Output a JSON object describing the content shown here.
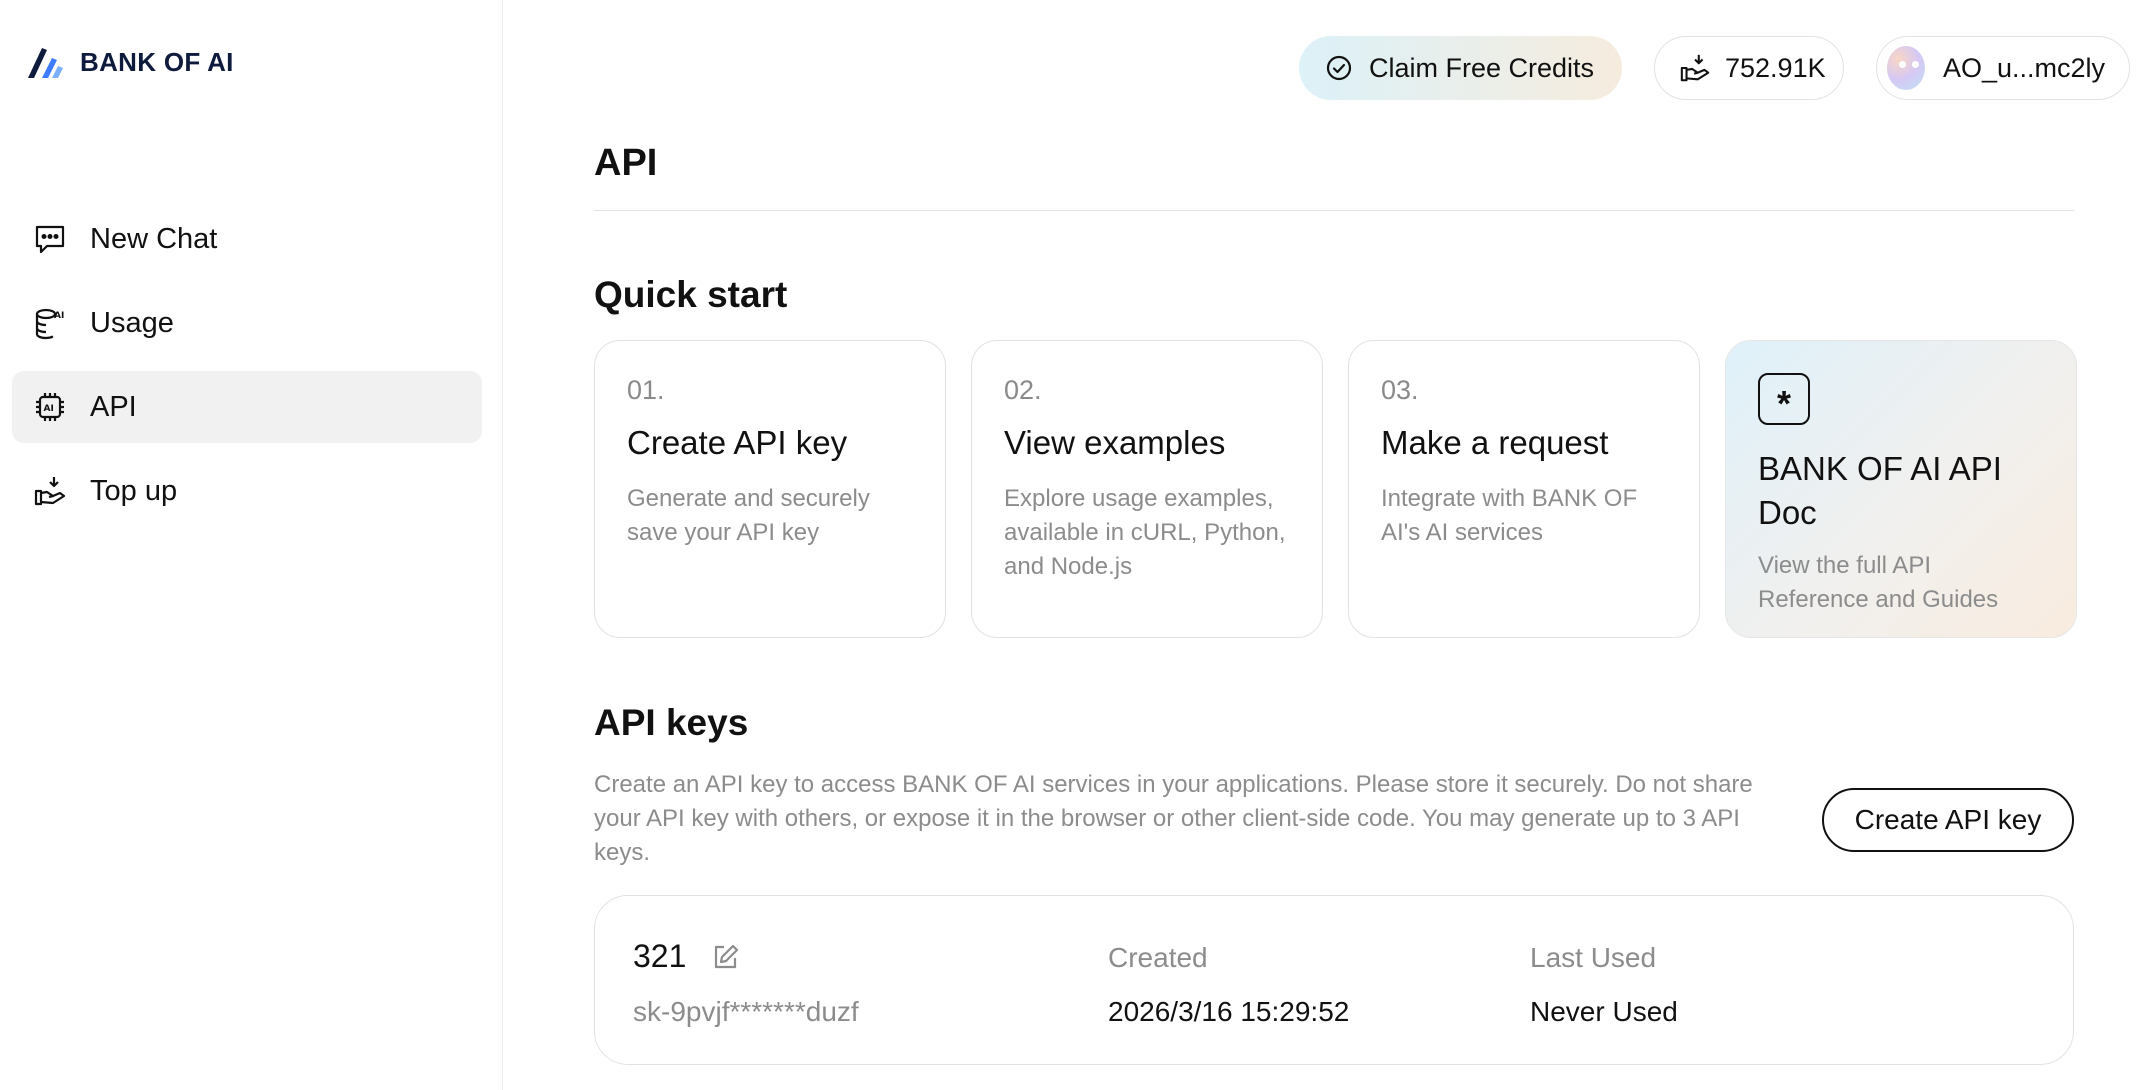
{
  "brand": {
    "name": "BANK OF AI"
  },
  "sidebar": {
    "items": [
      {
        "label": "New Chat",
        "icon": "chat-bubble-icon"
      },
      {
        "label": "Usage",
        "icon": "database-ai-icon"
      },
      {
        "label": "API",
        "icon": "ai-chip-icon",
        "active": true
      },
      {
        "label": "Top up",
        "icon": "hand-coin-icon"
      }
    ]
  },
  "header": {
    "claim_label": "Claim Free Credits",
    "balance": "752.91K",
    "username": "AO_u...mc2ly"
  },
  "page": {
    "title": "API",
    "quick_start": {
      "title": "Quick start",
      "cards": [
        {
          "num": "01.",
          "title": "Create API key",
          "desc": "Generate and securely save your API key"
        },
        {
          "num": "02.",
          "title": "View examples",
          "desc": "Explore usage examples, available in cURL, Python, and Node.js"
        },
        {
          "num": "03.",
          "title": "Make a request",
          "desc": "Integrate with BANK OF AI's AI services"
        }
      ],
      "doc_card": {
        "icon_glyph": "*",
        "title": "BANK OF AI API Doc",
        "desc": "View the full API Reference and Guides"
      }
    },
    "api_keys": {
      "title": "API keys",
      "description": "Create an API key to access BANK OF AI services in your applications. Please store it securely. Do not share your API key with others, or expose it in the browser or other client-side code. You may generate up to 3 API keys.",
      "create_label": "Create API key",
      "keys": [
        {
          "name": "321",
          "value": "sk-9pvjf*******duzf",
          "created_label": "Created",
          "created": "2026/3/16 15:29:52",
          "last_used_label": "Last Used",
          "last_used": "Never Used"
        }
      ]
    }
  },
  "colors": {
    "accent_blue": "#2f6bff",
    "logo_dark": "#0f1b3d",
    "muted_text": "#8c8c8c"
  }
}
